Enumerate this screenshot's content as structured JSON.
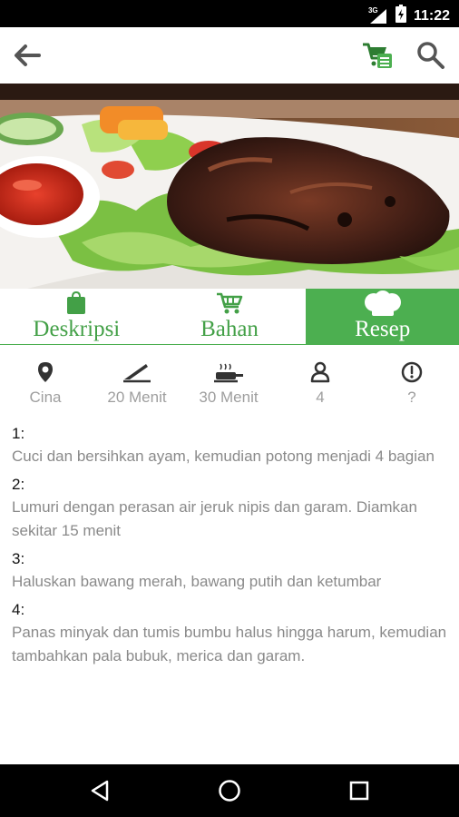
{
  "status_bar": {
    "time": "11:22",
    "signal_label": "3G",
    "icons": [
      "signal-icon",
      "battery-icon"
    ]
  },
  "app_bar": {
    "icons": [
      "back-arrow-icon",
      "cart-list-icon",
      "search-icon"
    ]
  },
  "colors": {
    "accent": "#4caf50",
    "accent_text": "#43a047",
    "muted_text": "#9e9e9e"
  },
  "tabs": [
    {
      "label": "Deskripsi",
      "icon": "bag-icon",
      "active": false
    },
    {
      "label": "Bahan",
      "icon": "cart-icon",
      "active": false
    },
    {
      "label": "Resep",
      "icon": "chef-hat-icon",
      "active": true
    }
  ],
  "info": [
    {
      "icon": "location-pin-icon",
      "value": "Cina"
    },
    {
      "icon": "knife-icon",
      "value": "20 Menit"
    },
    {
      "icon": "cooking-pan-icon",
      "value": "30 Menit"
    },
    {
      "icon": "person-icon",
      "value": "4"
    },
    {
      "icon": "alert-circle-icon",
      "value": "?"
    }
  ],
  "steps": [
    {
      "number": "1:",
      "text": "Cuci dan bersihkan ayam, kemudian potong menjadi 4 bagian"
    },
    {
      "number": "2:",
      "text": "Lumuri dengan perasan air jeruk nipis dan garam. Diamkan sekitar 15 menit"
    },
    {
      "number": "3:",
      "text": "Haluskan bawang merah, bawang putih dan ketumbar"
    },
    {
      "number": "4:",
      "text": "Panas minyak dan tumis bumbu halus hingga harum, kemudian tambahkan pala bubuk, merica dan garam."
    }
  ],
  "nav_bar": {
    "icons": [
      "back-triangle-icon",
      "home-circle-icon",
      "recents-square-icon"
    ]
  }
}
